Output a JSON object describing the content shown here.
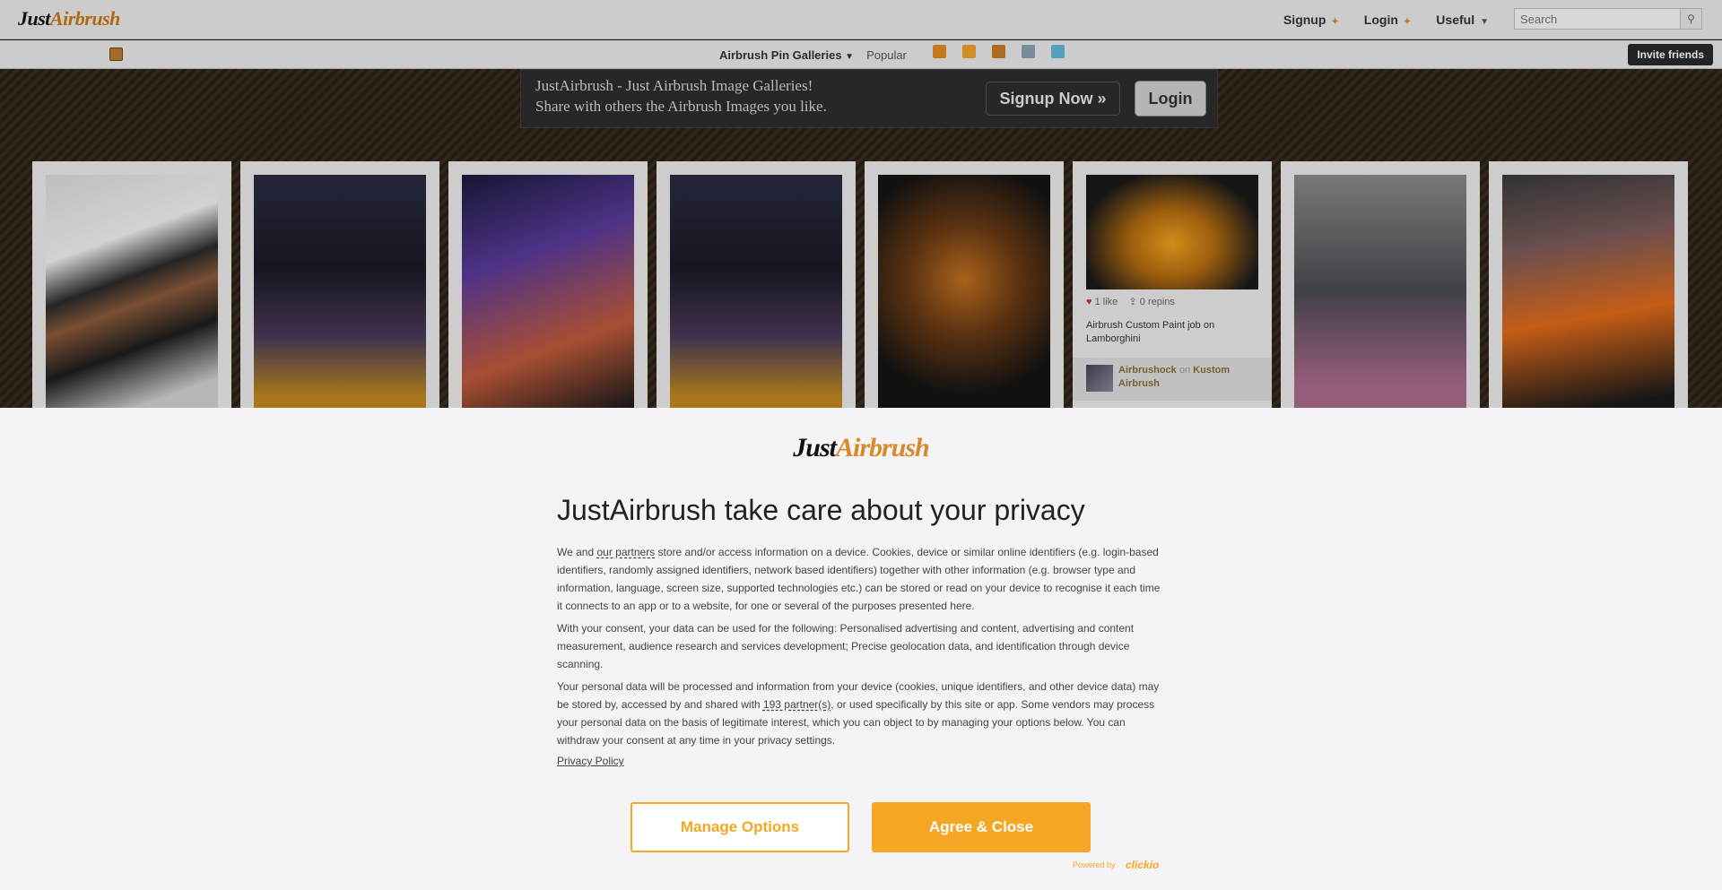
{
  "topbar": {
    "logo": {
      "just": "Just",
      "airbrush": "Airbrush"
    },
    "nav": [
      {
        "label": "Signup"
      },
      {
        "label": "Login"
      },
      {
        "label": "Useful"
      }
    ],
    "search": {
      "placeholder": "Search"
    }
  },
  "subbar": {
    "galleries_label": "Airbrush Pin Galleries",
    "popular_label": "Popular",
    "social_icons": [
      "rss-icon",
      "rss-alt-icon",
      "facebook-icon",
      "google-icon",
      "twitter-icon"
    ],
    "invite_label": "Invite friends"
  },
  "promo": {
    "line1": "JustAirbrush - Just Airbrush Image Galleries!",
    "line2": "Share with others the Airbrush Images you like.",
    "signup_label": "Signup Now »",
    "login_label": "Login"
  },
  "pins": [
    {
      "image": "airbrushed-motorcycle-tank"
    },
    {
      "image": "portrait-woman-dark-hair"
    },
    {
      "image": "portrait-woman-colorful"
    },
    {
      "image": "portrait-woman-dark-hair"
    },
    {
      "image": "portrait-woman-flames"
    },
    {
      "image": "orange-lamborghini",
      "likes": "1 like",
      "repins": "0 repins",
      "title": "Airbrush Custom Paint job on Lamborghini",
      "user": "Airbrushock",
      "on": "on",
      "board": "Kustom Airbrush"
    },
    {
      "image": "portrait-woman-profile"
    },
    {
      "image": "airbrushed-car-flames"
    }
  ],
  "consent": {
    "title": "JustAirbrush take care about your privacy",
    "p1_a": "We and ",
    "p1_link": "our partners",
    "p1_b": " store and/or access information on a device. Cookies, device or similar online identifiers (e.g. login-based identifiers, randomly assigned identifiers, network based identifiers) together with other information (e.g. browser type and information, language, screen size, supported technologies etc.) can be stored or read on your device to recognise it each time it connects to an app or to a website, for one or several of the purposes presented here.",
    "p2": "With your consent, your data can be used for the following: Personalised advertising and content, advertising and content measurement, audience research and services development; Precise geolocation data, and identification through device scanning.",
    "p3_a": "Your personal data will be processed and information from your device (cookies, unique identifiers, and other device data) may be stored by, accessed by and shared with ",
    "p3_link": "193 partner(s)",
    "p3_b": ", or used specifically by this site or app. Some vendors may process your personal data on the basis of legitimate interest, which you can object to by managing your options below. You can withdraw your consent at any time in your privacy settings.",
    "privacy_policy": "Privacy Policy",
    "manage_label": "Manage Options",
    "agree_label": "Agree & Close",
    "powered_by": "Powered by",
    "provider": "clickio"
  },
  "colors": {
    "accent": "#f5a623",
    "hero_bg": "#2a2118"
  }
}
